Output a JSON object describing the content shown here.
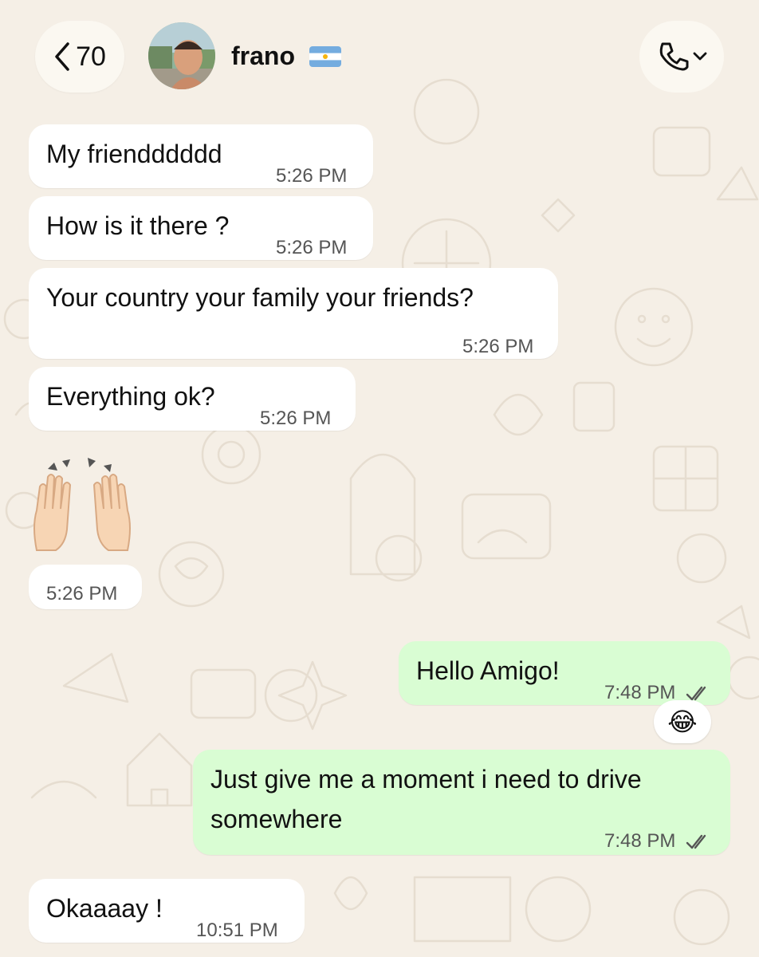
{
  "header": {
    "back_count": "70",
    "contact_name": "frano",
    "flag_icon": "argentina-flag-icon",
    "call_icon": "phone-icon"
  },
  "messages": [
    {
      "dir": "in",
      "text": "My friendddddd",
      "time": "5:26 PM"
    },
    {
      "dir": "in",
      "text": "How is it there ?",
      "time": "5:26 PM"
    },
    {
      "dir": "in",
      "text": "Your country your family your friends?",
      "time": "5:26 PM"
    },
    {
      "dir": "in",
      "text": "Everything ok?",
      "time": "5:26 PM"
    },
    {
      "dir": "in",
      "emoji": "raised-hands-emoji",
      "time": "5:26 PM"
    },
    {
      "dir": "out",
      "text": "Hello Amigo!",
      "time": "7:48 PM",
      "status": "read-double-check-icon",
      "reaction": "😂"
    },
    {
      "dir": "out",
      "text_line1": "Just give me a moment i need to drive",
      "text_line2": "somewhere",
      "time": "7:48 PM",
      "status": "read-double-check-icon"
    },
    {
      "dir": "in",
      "text": "Okaaaay !",
      "time": "10:51 PM"
    }
  ],
  "colors": {
    "background": "#f5efe6",
    "incoming_bubble": "#ffffff",
    "outgoing_bubble": "#d9fdd3",
    "timestamp": "#555555"
  }
}
